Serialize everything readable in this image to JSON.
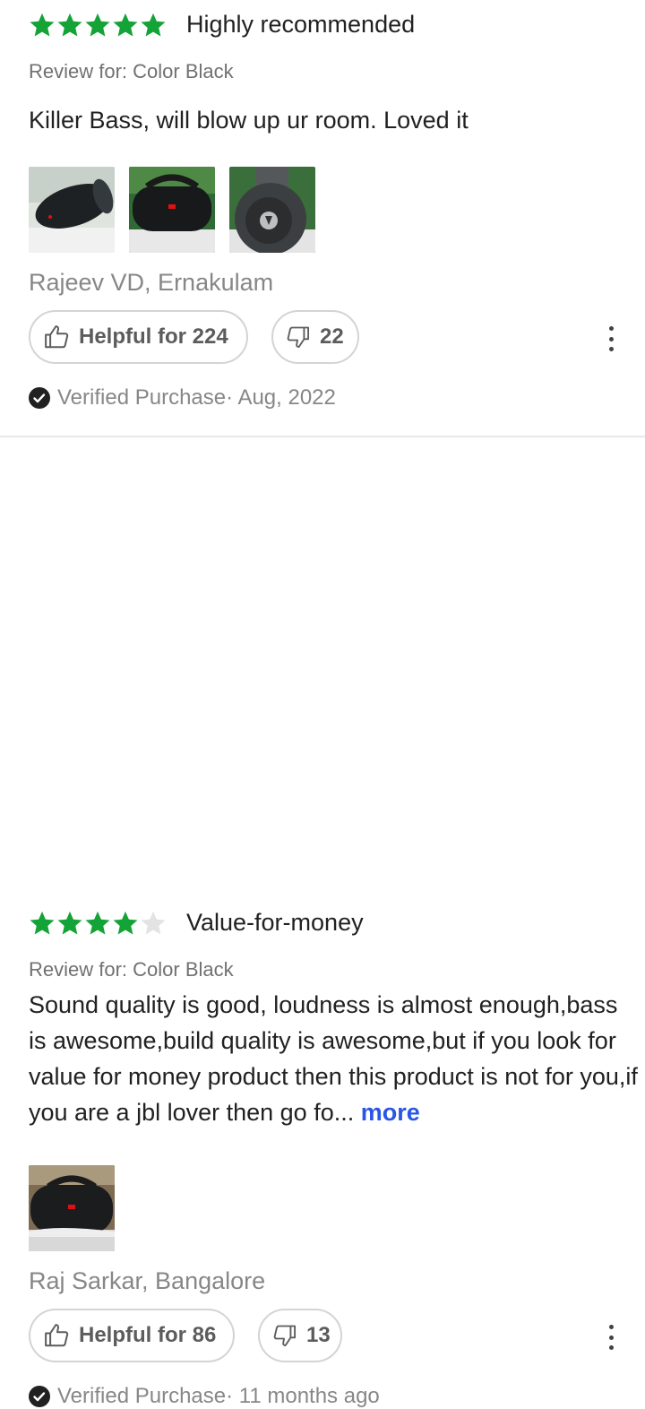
{
  "colors": {
    "star_filled": "#14a336",
    "star_empty": "#e3e3e3",
    "more_link": "#2a55e5",
    "muted_text": "#878787"
  },
  "reviews": [
    {
      "rating": 5,
      "max_rating": 5,
      "title": "Highly recommended",
      "variant": "Review for: Color Black",
      "body": "Killer Bass, will blow up ur room. Loved it",
      "more_label": "",
      "images": [
        "speaker-side-view",
        "speaker-front-view",
        "speaker-end-view"
      ],
      "author": "Rajeev VD, Ernakulam",
      "helpful_label": "Helpful for 224",
      "dislike_count": "22",
      "verified_label": "Verified Purchase",
      "date": "· Aug, 2022"
    },
    {
      "rating": 4,
      "max_rating": 5,
      "title": "Value-for-money",
      "variant": "Review for: Color Black",
      "body": "Sound quality is good, loudness is almost enough,bass is awesome,build quality is awesome,but if you look for value for money product then this product is not for you,if you are a jbl lover then go fo...",
      "more_label": "more",
      "images": [
        "speaker-front-view"
      ],
      "author": "Raj Sarkar, Bangalore",
      "helpful_label": "Helpful for 86",
      "dislike_count": "13",
      "verified_label": "Verified Purchase",
      "date": "· 11 months ago"
    }
  ]
}
